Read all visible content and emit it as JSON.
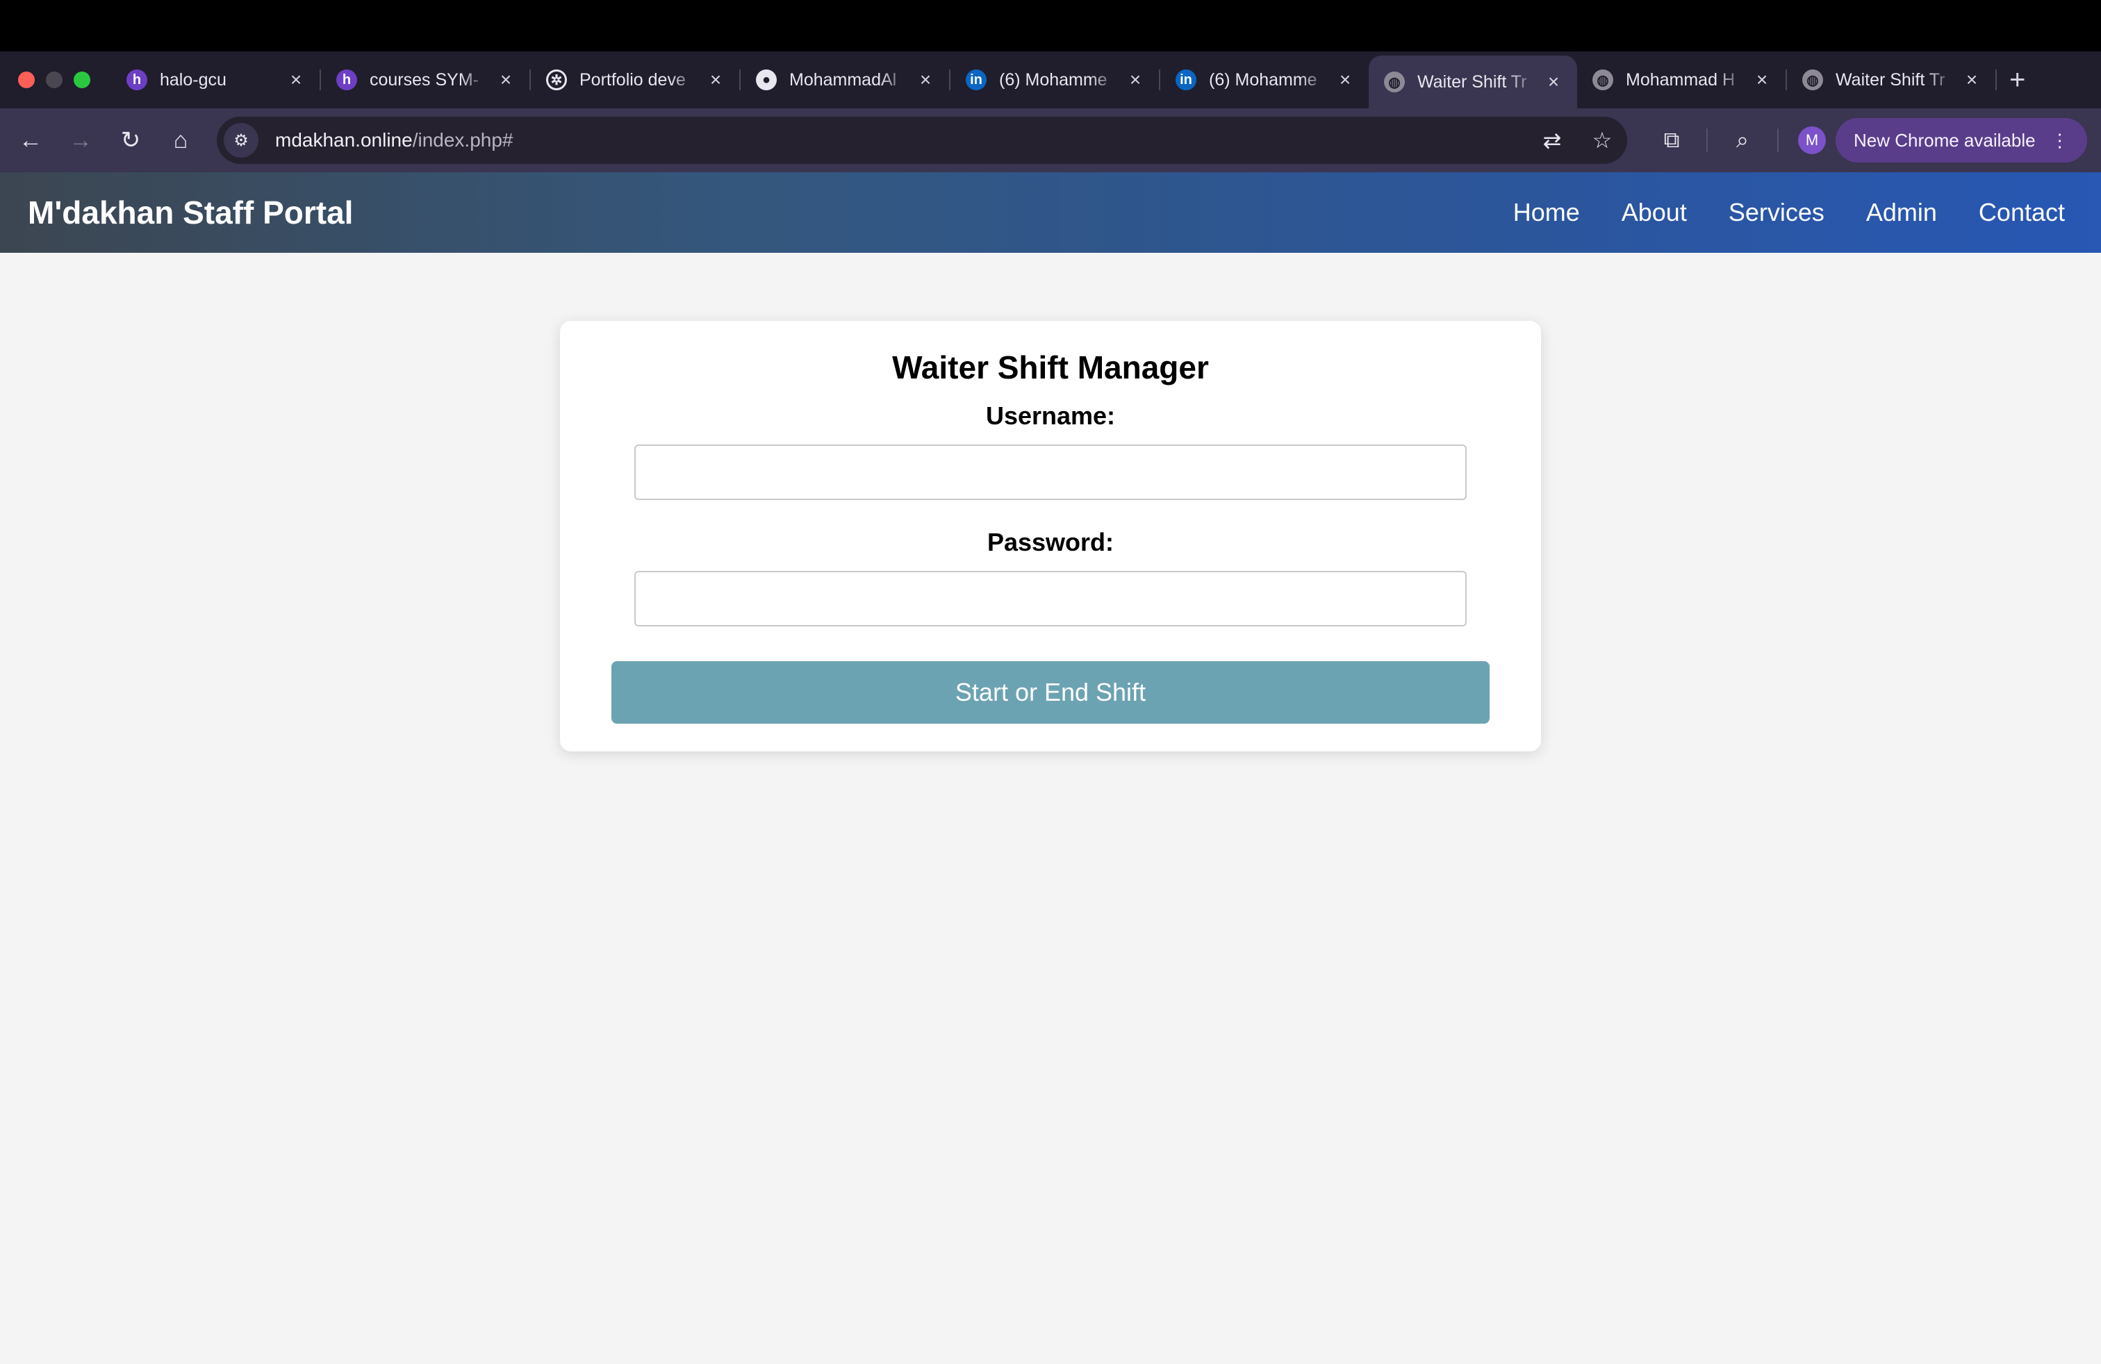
{
  "browser": {
    "tabs": [
      {
        "title": "halo-gcu",
        "icon": "halo-favicon-icon"
      },
      {
        "title": "courses SYM-",
        "icon": "halo-favicon-icon"
      },
      {
        "title": "Portfolio deve",
        "icon": "openai-favicon-icon"
      },
      {
        "title": "MohammadAl",
        "icon": "github-favicon-icon"
      },
      {
        "title": "(6) Mohamme",
        "icon": "linkedin-favicon-icon"
      },
      {
        "title": "(6) Mohamme",
        "icon": "linkedin-favicon-icon"
      },
      {
        "title": "Waiter Shift Tr",
        "icon": "globe-favicon-icon",
        "active": true
      },
      {
        "title": "Mohammad H",
        "icon": "globe-favicon-icon"
      },
      {
        "title": "Waiter Shift Tr",
        "icon": "globe-favicon-icon"
      }
    ],
    "url_host": "mdakhan.online",
    "url_path": "/index.php#",
    "avatar_initial": "M",
    "update_label": "New Chrome available"
  },
  "site": {
    "brand": "M'dakhan Staff Portal",
    "nav": [
      "Home",
      "About",
      "Services",
      "Admin",
      "Contact"
    ]
  },
  "form": {
    "title": "Waiter Shift Manager",
    "username_label": "Username:",
    "username_value": "",
    "password_label": "Password:",
    "password_value": "",
    "submit_label": "Start or End Shift",
    "button_color": "#6ca3b2"
  },
  "colors": {
    "header_gradient_start": "#3c4651",
    "header_gradient_end": "#2857b4",
    "page_background": "#f4f4f4"
  }
}
